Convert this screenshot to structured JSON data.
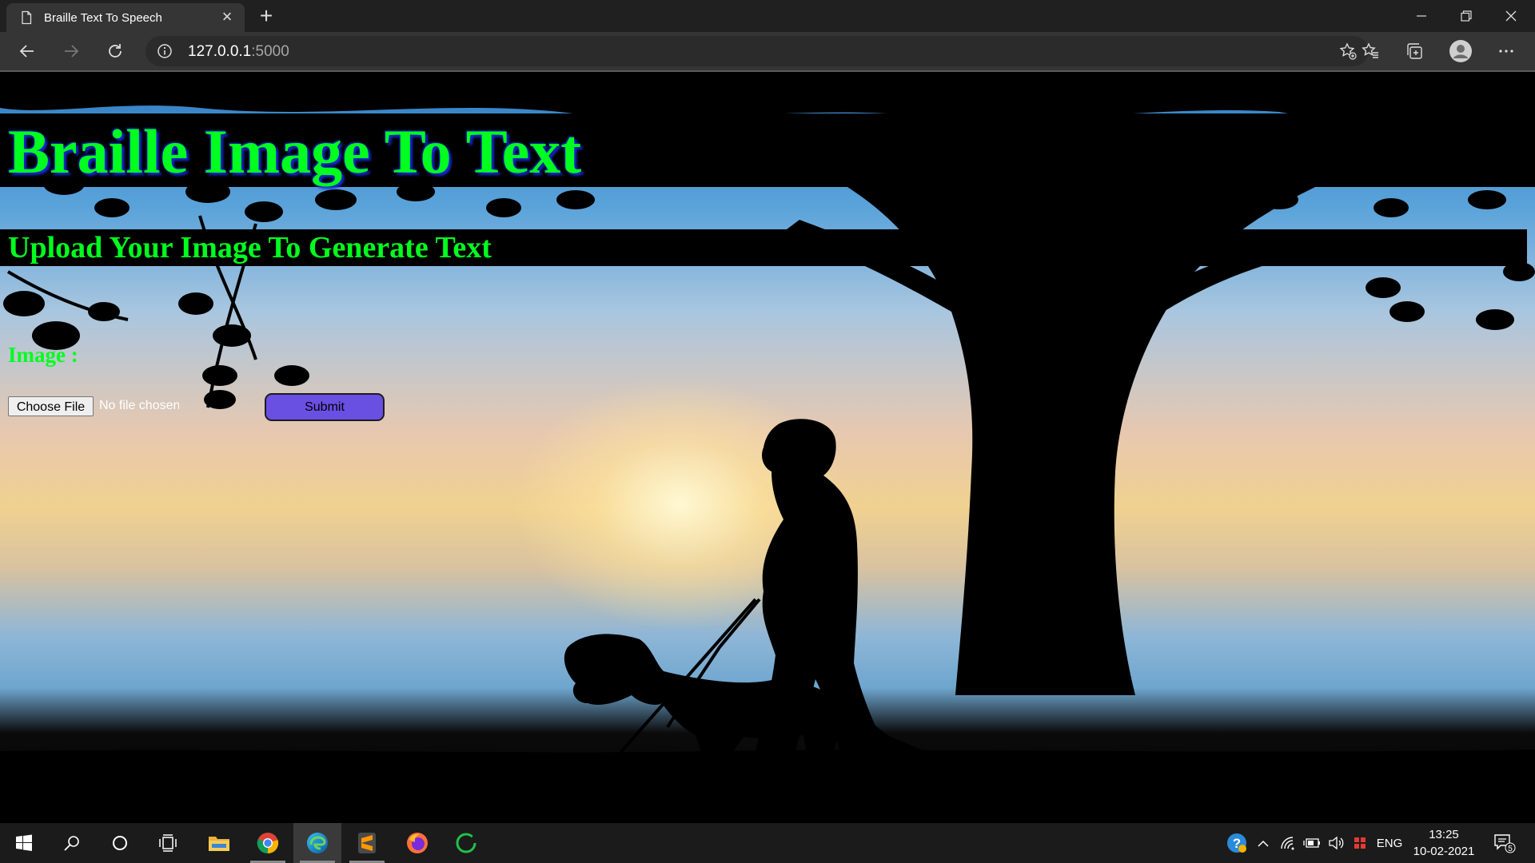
{
  "browser": {
    "tab_title": "Braille Text To Speech",
    "url_host": "127.0.0.1",
    "url_port": ":5000"
  },
  "page": {
    "heading": "Braille Image To Text",
    "subheading": "Upload Your Image To Generate Text",
    "image_label": "Image :",
    "choose_file_label": "Choose File",
    "file_status": "No file chosen",
    "submit_label": "Submit"
  },
  "taskbar": {
    "language": "ENG",
    "time": "13:25",
    "date": "10-02-2021",
    "notification_count": "5"
  }
}
